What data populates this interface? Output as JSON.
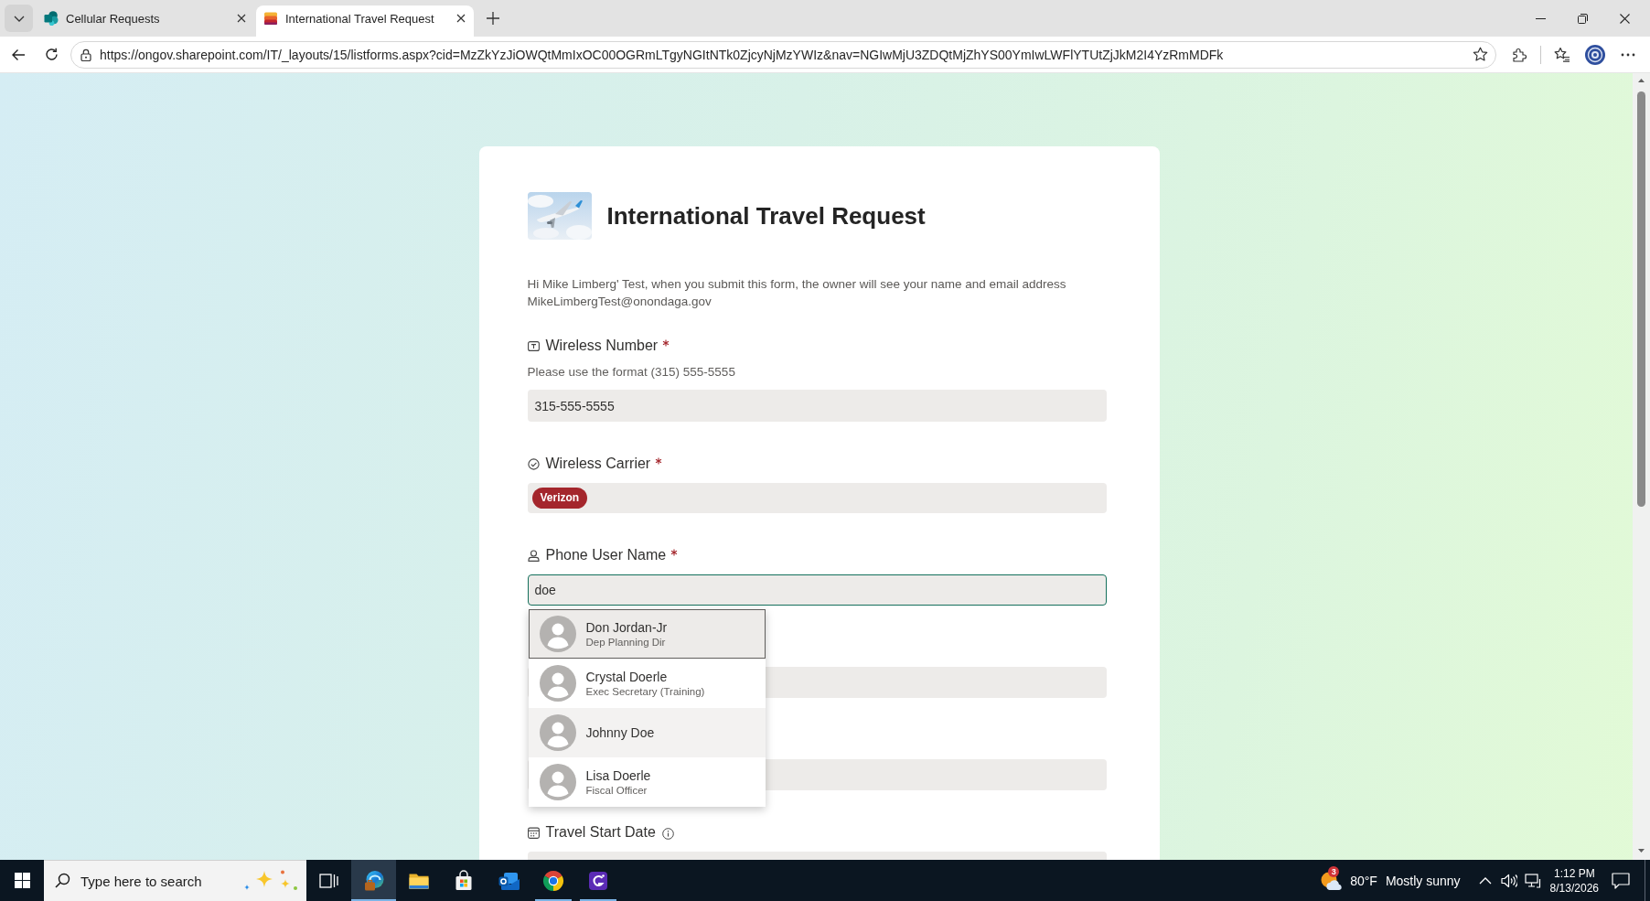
{
  "browser": {
    "tabs": [
      {
        "title": "Cellular Requests",
        "selected": false
      },
      {
        "title": "International Travel Request",
        "selected": true
      }
    ],
    "address": "https://ongov.sharepoint.com/IT/_layouts/15/listforms.aspx?cid=MzZkYzJiOWQtMmIxOC00OGRmLTgyNGItNTk0ZjcyNjMzYWIz&nav=NGIwMjU3ZDQtMjZhYS00YmIwLWFlYTUtZjJkM2I4YzRmMDFk"
  },
  "form": {
    "title": "International Travel Request",
    "intro": "Hi Mike Limberg' Test, when you submit this form, the owner will see your name and email address MikeLimbergTest@onondaga.gov",
    "fields": [
      {
        "kind": "text",
        "label": "Wireless Number",
        "required": true,
        "hint": "Please use the format (315) 555-5555",
        "value": "315-555-5555"
      },
      {
        "kind": "choice",
        "label": "Wireless Carrier",
        "required": true,
        "choices": [
          {
            "label": "Verizon",
            "color": "#a4262c"
          }
        ]
      },
      {
        "kind": "person",
        "label": "Phone User Name",
        "required": true,
        "value": "doe",
        "focused": true,
        "suggestions": [
          {
            "name": "Don Jordan-Jr",
            "title": "Dep Planning Dir",
            "selected": true,
            "hovered": false
          },
          {
            "name": "Crystal Doerle",
            "title": "Exec Secretary (Training)",
            "selected": false,
            "hovered": false
          },
          {
            "name": "Johnny Doe",
            "selected": false,
            "hovered": true
          },
          {
            "name": "Lisa Doerle",
            "title": "Fiscal Officer",
            "selected": false,
            "hovered": false
          }
        ]
      },
      {
        "kind": "text"
      },
      {
        "kind": "text"
      },
      {
        "kind": "date",
        "label": "Travel Start Date",
        "required": false,
        "info": true
      }
    ]
  },
  "taskbar": {
    "search_placeholder": "Type here to search",
    "apps": [
      {
        "selected": false,
        "running": false
      },
      {
        "selected": true,
        "running": true
      },
      {
        "selected": false,
        "running": false
      },
      {
        "selected": false,
        "running": false
      },
      {
        "selected": false,
        "running": false
      },
      {
        "selected": false,
        "running": true
      },
      {
        "selected": false,
        "running": true
      }
    ],
    "weather": {
      "badge": "3",
      "temperature": "80°F",
      "condition": "Mostly sunny"
    },
    "clock": {
      "time": "1:12 PM",
      "date": "8/13/2026"
    }
  }
}
